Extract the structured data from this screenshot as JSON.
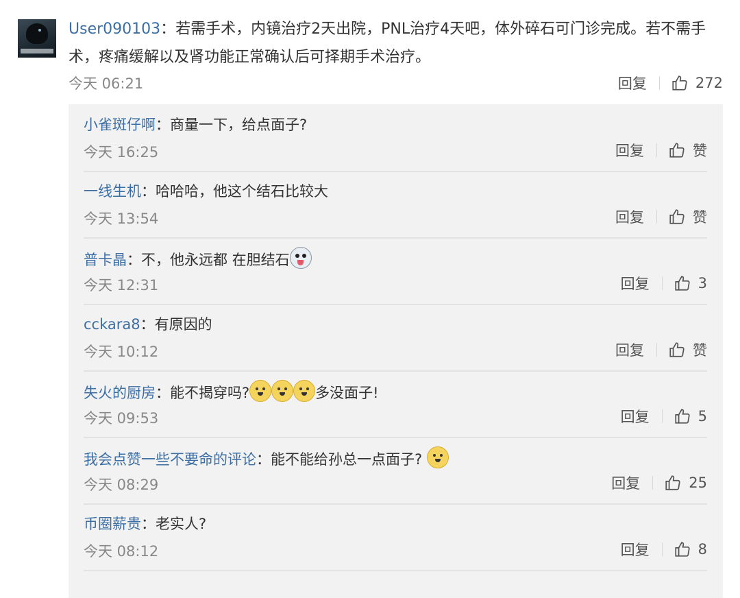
{
  "main_comment": {
    "username": "User090103",
    "text": "：若需手术，内镜治疗2天出院，PNL治疗4天吧，体外碎石可门诊完成。若不需手术，疼痛缓解以及肾功能正常确认后可择期手术治疗。",
    "time": "今天 06:21",
    "reply_label": "回复",
    "likes": "272",
    "avatar_caption": "Crow of Judgement"
  },
  "replies": [
    {
      "username": "小雀斑仔啊",
      "text": "：商量一下，给点面子?",
      "time": "今天 16:25",
      "reply_label": "回复",
      "likes": "赞"
    },
    {
      "username": "一线生机",
      "text": "：哈哈哈，他这个结石比较大",
      "time": "今天 13:54",
      "reply_label": "回复",
      "likes": "赞"
    },
    {
      "username": "普卡晶",
      "text": "：不，他永远都  在胆结石",
      "time": "今天 12:31",
      "reply_label": "回复",
      "likes": "3",
      "emoji": "husky-emoji"
    },
    {
      "username": "cckara8",
      "text": "：有原因的",
      "time": "今天 10:12",
      "reply_label": "回复",
      "likes": "赞"
    },
    {
      "username": "失火的厨房",
      "text": "：能不揭穿吗?",
      "text_after": "多没面子!",
      "time": "今天 09:53",
      "reply_label": "回复",
      "likes": "5",
      "emoji": "doge-emoji"
    },
    {
      "username": "我会点赞一些不要命的评论",
      "text": "：能不能给孙总一点面子?",
      "time": "今天 08:29",
      "reply_label": "回复",
      "likes": "25",
      "emoji": "doge-emoji"
    },
    {
      "username": "币圈薪贵",
      "text": "：老实人?",
      "time": "今天 08:12",
      "reply_label": "回复",
      "likes": "8"
    }
  ],
  "colors": {
    "username": "#3b6ea5",
    "text": "#333333",
    "meta": "#888888",
    "sub_bg": "#f2f2f2"
  }
}
